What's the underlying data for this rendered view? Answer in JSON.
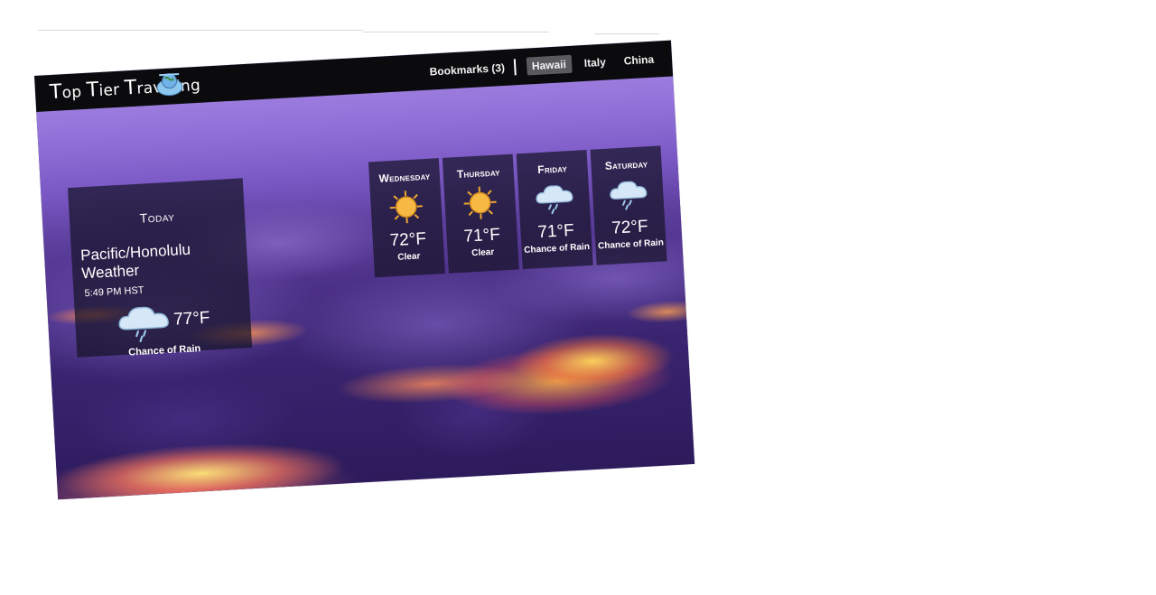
{
  "navbar": {
    "brand": {
      "part1_cap": "T",
      "part1": "op ",
      "part2_cap": "T",
      "part2": "ier ",
      "part3_cap": "T",
      "part3": "raveling"
    },
    "links": [
      {
        "label": "Bookmarks (3)",
        "active": false
      },
      {
        "label": "Hawaii",
        "active": true
      },
      {
        "label": "Italy",
        "active": false
      },
      {
        "label": "China",
        "active": false
      }
    ]
  },
  "today": {
    "title": "Today",
    "city_label": "Pacific/Honolulu Weather",
    "time": "5:49 PM HST",
    "icon": "rain-cloud-icon",
    "temperature": "77°F",
    "condition": "Chance of Rain"
  },
  "forecast": [
    {
      "day": "Wednesday",
      "icon": "sun-icon",
      "temperature": "72°F",
      "condition": "Clear"
    },
    {
      "day": "Thursday",
      "icon": "sun-icon",
      "temperature": "71°F",
      "condition": "Clear"
    },
    {
      "day": "Friday",
      "icon": "rain-cloud-icon",
      "temperature": "71°F",
      "condition": "Chance of Rain"
    },
    {
      "day": "Saturday",
      "icon": "rain-cloud-icon",
      "temperature": "72°F",
      "condition": "Chance of Rain"
    }
  ],
  "colors": {
    "navbar": "#0b0b0e",
    "active_link": "#5a5a5e",
    "panel": "rgba(22,20,40,0.72)",
    "sun": "#f2b23a",
    "cloud": "#cfe3f5"
  }
}
